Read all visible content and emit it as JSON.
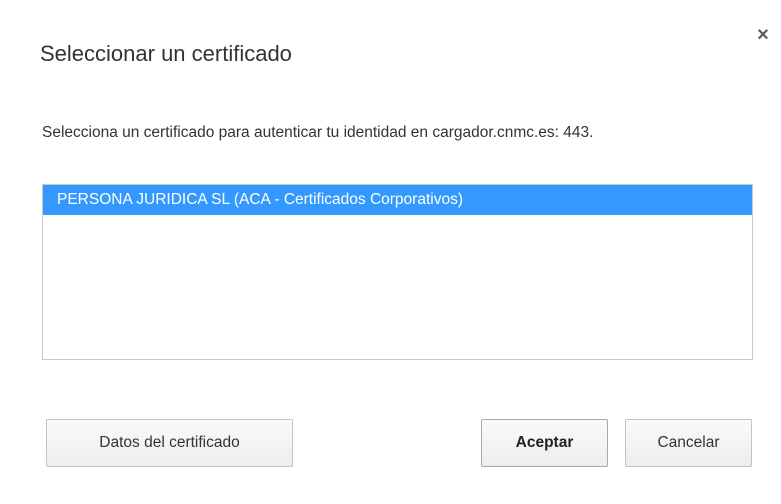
{
  "dialog": {
    "title": "Seleccionar un certificado",
    "close_icon": "×",
    "description": "Selecciona un certificado para autenticar tu identidad en cargador.cnmc.es: 443.",
    "certificates": [
      {
        "label": "PERSONA JURIDICA SL (ACA - Certificados Corporativos)",
        "selected": true
      }
    ],
    "buttons": {
      "details": "Datos del certificado",
      "accept": "Aceptar",
      "cancel": "Cancelar"
    }
  },
  "colors": {
    "selection": "#3399ff",
    "text": "#333333",
    "border": "#c8c8c8"
  }
}
